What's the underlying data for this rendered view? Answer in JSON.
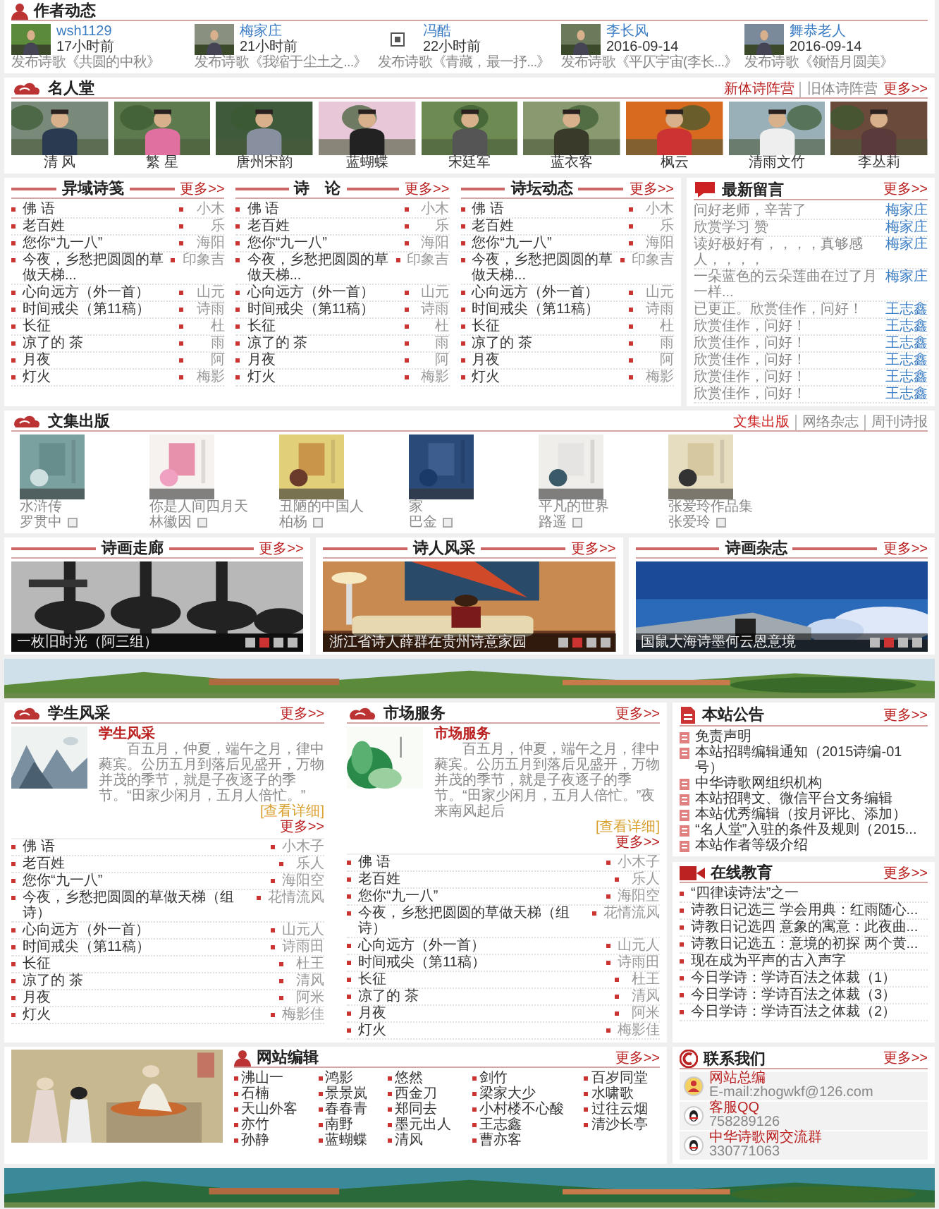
{
  "author_updates": {
    "title": "作者动态",
    "items": [
      {
        "name": "wsh1129",
        "time": "17小时前",
        "action": "发布诗歌《共圆的中秋》"
      },
      {
        "name": "梅家庄",
        "time": "21小时前",
        "action": "发布诗歌《我缩于尘土之...》"
      },
      {
        "kind": "broken",
        "name": "冯酷",
        "time": "22小时前",
        "action": "发布诗歌《青藏，最一抒...》"
      },
      {
        "name": "李长风",
        "time": "2016-09-14",
        "action": "发布诗歌《平仄宇宙(李长...》"
      },
      {
        "name": "舞恭老人",
        "time": "2016-09-14",
        "action": "发布诗歌《领悟月圆美》"
      }
    ]
  },
  "hall_of_fame": {
    "title": "名人堂",
    "links": [
      "新体诗阵营",
      "旧体诗阵营"
    ],
    "more": "更多>>",
    "people": [
      {
        "name": "清 风"
      },
      {
        "name": "繁 星"
      },
      {
        "name": "唐州宋韵"
      },
      {
        "name": "蓝蝴蝶"
      },
      {
        "name": "宋廷军"
      },
      {
        "name": "蓝衣客"
      },
      {
        "name": "枫云"
      },
      {
        "name": "清雨文竹"
      },
      {
        "name": "李丛莉"
      }
    ]
  },
  "article_lists": [
    {
      "title": "异域诗笺",
      "more": "更多>>",
      "rows": [
        {
          "title": "佛 语",
          "author": "小木"
        },
        {
          "title": "老百姓",
          "author": "乐"
        },
        {
          "title": "您你“九一八”",
          "author": "海阳"
        },
        {
          "title": "今夜，乡愁把圆圆的草做天梯...",
          "author": "印象吉"
        },
        {
          "title": "心向远方（外一首）",
          "author": "山元"
        },
        {
          "title": "时间戒尖（第11稿）",
          "author": "诗雨"
        },
        {
          "title": "长征",
          "author": "杜"
        },
        {
          "title": "凉了的 茶",
          "author": "雨"
        },
        {
          "title": "月夜",
          "author": "阿"
        },
        {
          "title": "灯火",
          "author": "梅影"
        }
      ]
    },
    {
      "title": "诗　论",
      "more": "更多>>",
      "rows": [
        {
          "title": "佛 语",
          "author": "小木"
        },
        {
          "title": "老百姓",
          "author": "乐"
        },
        {
          "title": "您你“九一八”",
          "author": "海阳"
        },
        {
          "title": "今夜，乡愁把圆圆的草做天梯...",
          "author": "印象吉"
        },
        {
          "title": "心向远方（外一首）",
          "author": "山元"
        },
        {
          "title": "时间戒尖（第11稿）",
          "author": "诗雨"
        },
        {
          "title": "长征",
          "author": "杜"
        },
        {
          "title": "凉了的 茶",
          "author": "雨"
        },
        {
          "title": "月夜",
          "author": "阿"
        },
        {
          "title": "灯火",
          "author": "梅影"
        }
      ]
    },
    {
      "title": "诗坛动态",
      "more": "更多>>",
      "rows": [
        {
          "title": "佛 语",
          "author": "小木"
        },
        {
          "title": "老百姓",
          "author": "乐"
        },
        {
          "title": "您你“九一八”",
          "author": "海阳"
        },
        {
          "title": "今夜，乡愁把圆圆的草做天梯...",
          "author": "印象吉"
        },
        {
          "title": "心向远方（外一首）",
          "author": "山元"
        },
        {
          "title": "时间戒尖（第11稿）",
          "author": "诗雨"
        },
        {
          "title": "长征",
          "author": "杜"
        },
        {
          "title": "凉了的 茶",
          "author": "雨"
        },
        {
          "title": "月夜",
          "author": "阿"
        },
        {
          "title": "灯火",
          "author": "梅影"
        }
      ]
    }
  ],
  "latest_messages": {
    "title": "最新留言",
    "more": "更多>>",
    "rows": [
      {
        "text": "问好老师，辛苦了",
        "author": "梅家庄"
      },
      {
        "text": "欣赏学习 赞",
        "author": "梅家庄"
      },
      {
        "text": "读好极好有，，，，真够感人，，，，",
        "author": "梅家庄"
      },
      {
        "text": "一朵蓝色的云朵莲曲在过了月一样...",
        "author": "梅家庄"
      },
      {
        "text": "已更正。欣赏佳作，问好！",
        "author": "王志鑫"
      },
      {
        "text": "欣赏佳作，问好！",
        "author": "王志鑫"
      },
      {
        "text": "欣赏佳作，问好！",
        "author": "王志鑫"
      },
      {
        "text": "欣赏佳作，问好！",
        "author": "王志鑫"
      },
      {
        "text": "欣赏佳作，问好！",
        "author": "王志鑫"
      },
      {
        "text": "欣赏佳作，问好！",
        "author": "王志鑫"
      }
    ]
  },
  "collections": {
    "title": "文集出版",
    "links": [
      {
        "label": "文集出版",
        "selected": true
      },
      {
        "label": "网络杂志",
        "selected": false
      },
      {
        "label": "周刊诗报",
        "selected": false
      }
    ],
    "books": [
      {
        "title": "水浒传",
        "author": "罗贯中"
      },
      {
        "title": "你是人间四月天",
        "author": "林徽因"
      },
      {
        "title": "丑陋的中国人",
        "author": "柏杨"
      },
      {
        "title": "家",
        "author": "巴金"
      },
      {
        "title": "平凡的世界",
        "author": "路遥"
      },
      {
        "title": "张爱玲作品集",
        "author": "张爱玲"
      }
    ]
  },
  "galleries": [
    {
      "title": "诗画走廊",
      "more": "更多>>",
      "caption": "一枚旧时光（阿三组）",
      "pager": [
        {
          "selected": false
        },
        {
          "selected": true
        },
        {
          "selected": false
        },
        {
          "selected": false
        }
      ]
    },
    {
      "title": "诗人风采",
      "more": "更多>>",
      "caption": "浙江省诗人薛群在贵州诗意家园",
      "pager": [
        {
          "selected": false
        },
        {
          "selected": true
        },
        {
          "selected": false
        },
        {
          "selected": false
        }
      ]
    },
    {
      "title": "诗画杂志",
      "more": "更多>>",
      "caption": "国鼠大海诗墨何云恩意境",
      "pager": [
        {
          "selected": false
        },
        {
          "selected": true
        },
        {
          "selected": false
        },
        {
          "selected": false
        }
      ]
    }
  ],
  "feature_panels": [
    {
      "title": "学生风采",
      "more": "更多>>",
      "intro_heading": "学生风采",
      "intro_text": "　　百五月，仲夏，端午之月，律中蕤宾。公历五月到落后见盛开，万物并茂的季节，就是子夜逐子的季节。“田家少闲月，五月人倍忙。”",
      "detail_link": "[查看详细]",
      "list_more": "更多>>",
      "rows": [
        {
          "title": "佛 语",
          "author": "小木子"
        },
        {
          "title": "老百姓",
          "author": "乐人"
        },
        {
          "title": "您你“九一八”",
          "author": "海阳空"
        },
        {
          "title": "今夜，乡愁把圆圆的草做天梯（组诗）",
          "author": "花情流风"
        },
        {
          "title": "心向远方（外一首）",
          "author": "山元人"
        },
        {
          "title": "时间戒尖（第11稿）",
          "author": "诗雨田"
        },
        {
          "title": "长征",
          "author": "杜王"
        },
        {
          "title": "凉了的 茶",
          "author": "清风"
        },
        {
          "title": "月夜",
          "author": "阿米"
        },
        {
          "title": "灯火",
          "author": "梅影佳"
        }
      ]
    },
    {
      "title": "市场服务",
      "more": "更多>>",
      "intro_heading": "市场服务",
      "intro_text": "　　百五月，仲夏，端午之月，律中蕤宾。公历五月到落后见盛开，万物并茂的季节，就是子夜逐子的季节。“田家少闲月，五月人倍忙。”夜来南风起后",
      "detail_link": "[查看详细]",
      "list_more": "更多>>",
      "rows": [
        {
          "title": "佛 语",
          "author": "小木子"
        },
        {
          "title": "老百姓",
          "author": "乐人"
        },
        {
          "title": "您你“九一八”",
          "author": "海阳空"
        },
        {
          "title": "今夜，乡愁把圆圆的草做天梯（组诗）",
          "author": "花情流风"
        },
        {
          "title": "心向远方（外一首）",
          "author": "山元人"
        },
        {
          "title": "时间戒尖（第11稿）",
          "author": "诗雨田"
        },
        {
          "title": "长征",
          "author": "杜王"
        },
        {
          "title": "凉了的 茶",
          "author": "清风"
        },
        {
          "title": "月夜",
          "author": "阿米"
        },
        {
          "title": "灯火",
          "author": "梅影佳"
        }
      ]
    }
  ],
  "notices": {
    "title": "本站公告",
    "more": "更多>>",
    "items": [
      "免责声明",
      "本站招聘编辑通知（2015诗编-01号）",
      "中华诗歌网组织机构",
      "本站招聘文、微信平台文务编辑",
      "本站优秀编辑（按月评比、添加）",
      "“名人堂”入驻的条件及规则（2015...",
      "本站作者等级介绍"
    ]
  },
  "online_education": {
    "title": "在线教育",
    "more": "更多>>",
    "items": [
      "“四律读诗法”之一",
      "诗教日记选三 学会用典：红雨随心...",
      "诗教日记选四 意象的寓意：此夜曲...",
      "诗教日记选五：意境的初探 两个黄...",
      "现在成为平声的古入声字",
      "今日学诗：学诗百法之体裁（1）",
      "今日学诗：学诗百法之体裁（3）",
      "今日学诗：学诗百法之体裁（2）"
    ]
  },
  "site_editors": {
    "title": "网站编辑",
    "more": "更多>>",
    "names": [
      "沸山一",
      "鸿影",
      "悠然",
      "剑竹",
      "百岁同堂",
      "石楠",
      "景景岚",
      "西金刀",
      "梁家大少",
      "水啸歌",
      "天山外客",
      "春春青",
      "郑同去",
      "小村楼不心酸",
      "过往云烟",
      "亦竹",
      "南野",
      "墨元出人",
      "王志鑫",
      "清沙长亭",
      "孙静",
      "蓝蝴蝶",
      "清风",
      "曹亦客"
    ]
  },
  "contact": {
    "title": "联系我们",
    "more": "更多>>",
    "items": [
      {
        "kind": "email",
        "label": "网站总编",
        "value": "E-mail:zhogwkf@126.com"
      },
      {
        "kind": "qq",
        "label": "客服QQ",
        "value": "758289126"
      },
      {
        "kind": "qq",
        "label": "中华诗歌网交流群",
        "value": "330771063"
      }
    ]
  }
}
